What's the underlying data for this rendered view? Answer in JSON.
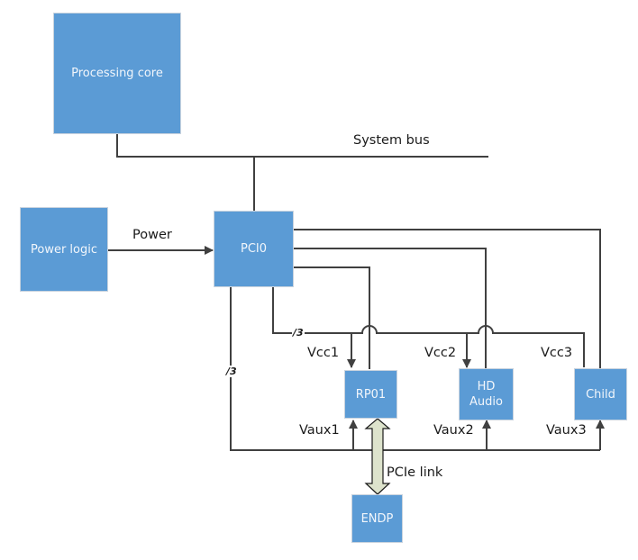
{
  "colors": {
    "block_fill": "#5b9bd5",
    "block_text": "#f2f6fb",
    "line": "#404040",
    "link_fill": "#dde3cc"
  },
  "blocks": {
    "processing_core": "Processing core",
    "power_logic": "Power logic",
    "pci0": "PCI0",
    "rp01": "RP01",
    "hd_audio": "HD\nAudio",
    "child": "Child",
    "endp": "ENDP"
  },
  "labels": {
    "system_bus": "System bus",
    "power": "Power",
    "vcc1": "Vcc1",
    "vcc2": "Vcc2",
    "vcc3": "Vcc3",
    "vaux1": "Vaux1",
    "vaux2": "Vaux2",
    "vaux3": "Vaux3",
    "pcie_link": "PCIe link",
    "bus_width_vcc": "/3",
    "bus_width_vaux": "/3"
  }
}
